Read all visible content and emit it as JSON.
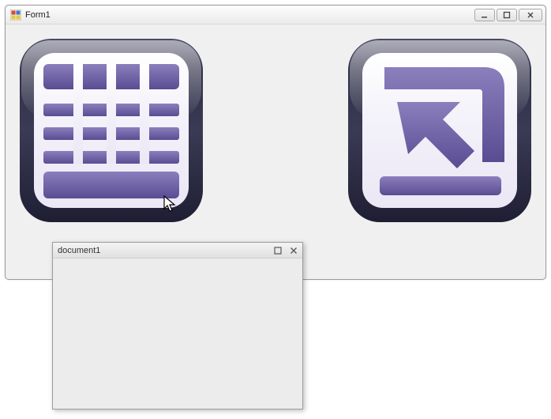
{
  "main_window": {
    "title": "Form1"
  },
  "child_window": {
    "title": "document1"
  },
  "icons": {
    "left_icon_name": "table-grid-icon",
    "right_icon_name": "arrow-enter-icon"
  }
}
